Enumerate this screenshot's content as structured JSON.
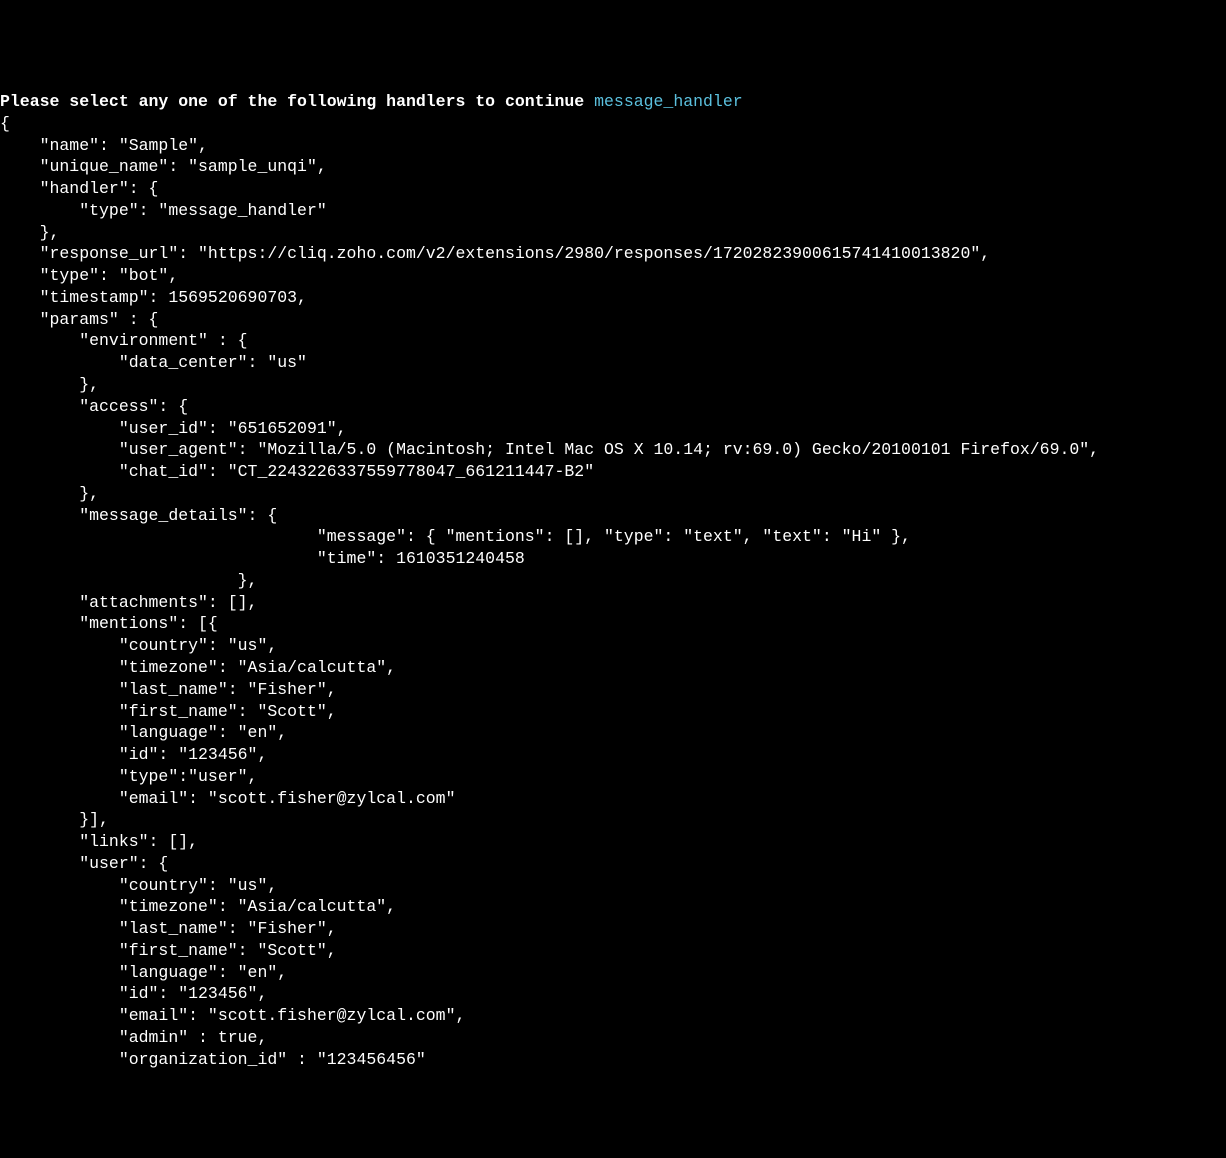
{
  "prompt": {
    "text": "Please select any one of the following handlers to continue ",
    "handler": "message_handler"
  },
  "payload": {
    "name": "Sample",
    "unique_name": "sample_unqi",
    "handler": {
      "type": "message_handler"
    },
    "response_url": "https://cliq.zoho.com/v2/extensions/2980/responses/17202823900615741410013820",
    "type": "bot",
    "timestamp": 1569520690703,
    "params": {
      "environment": {
        "data_center": "us"
      },
      "access": {
        "user_id": "651652091",
        "user_agent": "Mozilla/5.0 (Macintosh; Intel Mac OS X 10.14; rv:69.0) Gecko/20100101 Firefox/69.0",
        "chat_id": "CT_2243226337559778047_661211447-B2"
      },
      "message_details": {
        "message": {
          "mentions": [],
          "type": "text",
          "text": "Hi"
        },
        "time": 1610351240458
      },
      "attachments": [],
      "mentions": [
        {
          "country": "us",
          "timezone": "Asia/calcutta",
          "last_name": "Fisher",
          "first_name": "Scott",
          "language": "en",
          "id": "123456",
          "type": "user",
          "email": "scott.fisher@zylcal.com"
        }
      ],
      "links": [],
      "user": {
        "country": "us",
        "timezone": "Asia/calcutta",
        "last_name": "Fisher",
        "first_name": "Scott",
        "language": "en",
        "id": "123456",
        "email": "scott.fisher@zylcal.com",
        "admin": true,
        "organization_id": "123456456"
      }
    }
  }
}
